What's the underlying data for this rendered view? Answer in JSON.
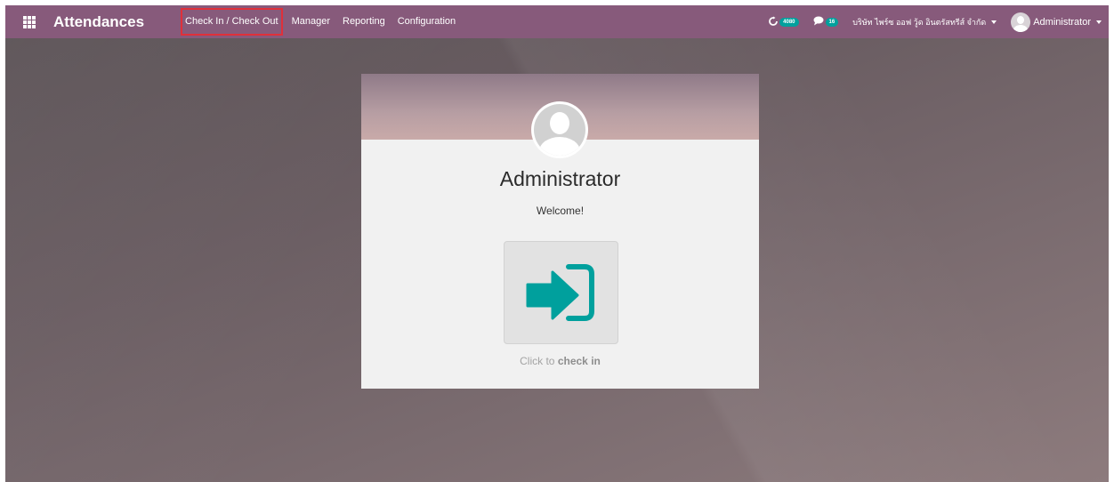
{
  "navbar": {
    "apps_icon": "apps-grid-icon",
    "app_title": "Attendances",
    "menu": [
      {
        "label": "Check In / Check Out",
        "active": true
      },
      {
        "label": "Manager",
        "active": false
      },
      {
        "label": "Reporting",
        "active": false
      },
      {
        "label": "Configuration",
        "active": false
      }
    ],
    "activity": {
      "icon": "clock-icon",
      "count": "4080"
    },
    "messages": {
      "icon": "chat-icon",
      "count": "16"
    },
    "company": "บริษัท ไพร์ซ ออฟ วู้ด อินตรัสทรีส์ จำกัด",
    "user": "Administrator"
  },
  "card": {
    "employee_name": "Administrator",
    "welcome": "Welcome!",
    "action_icon": "sign-in-icon",
    "hint_prefix": "Click to",
    "hint_action": "check in"
  },
  "colors": {
    "navbar": "#875a7b",
    "badge": "#00a09d",
    "checkin_icon": "#00a09d",
    "active_highlight": "#e0303a"
  }
}
